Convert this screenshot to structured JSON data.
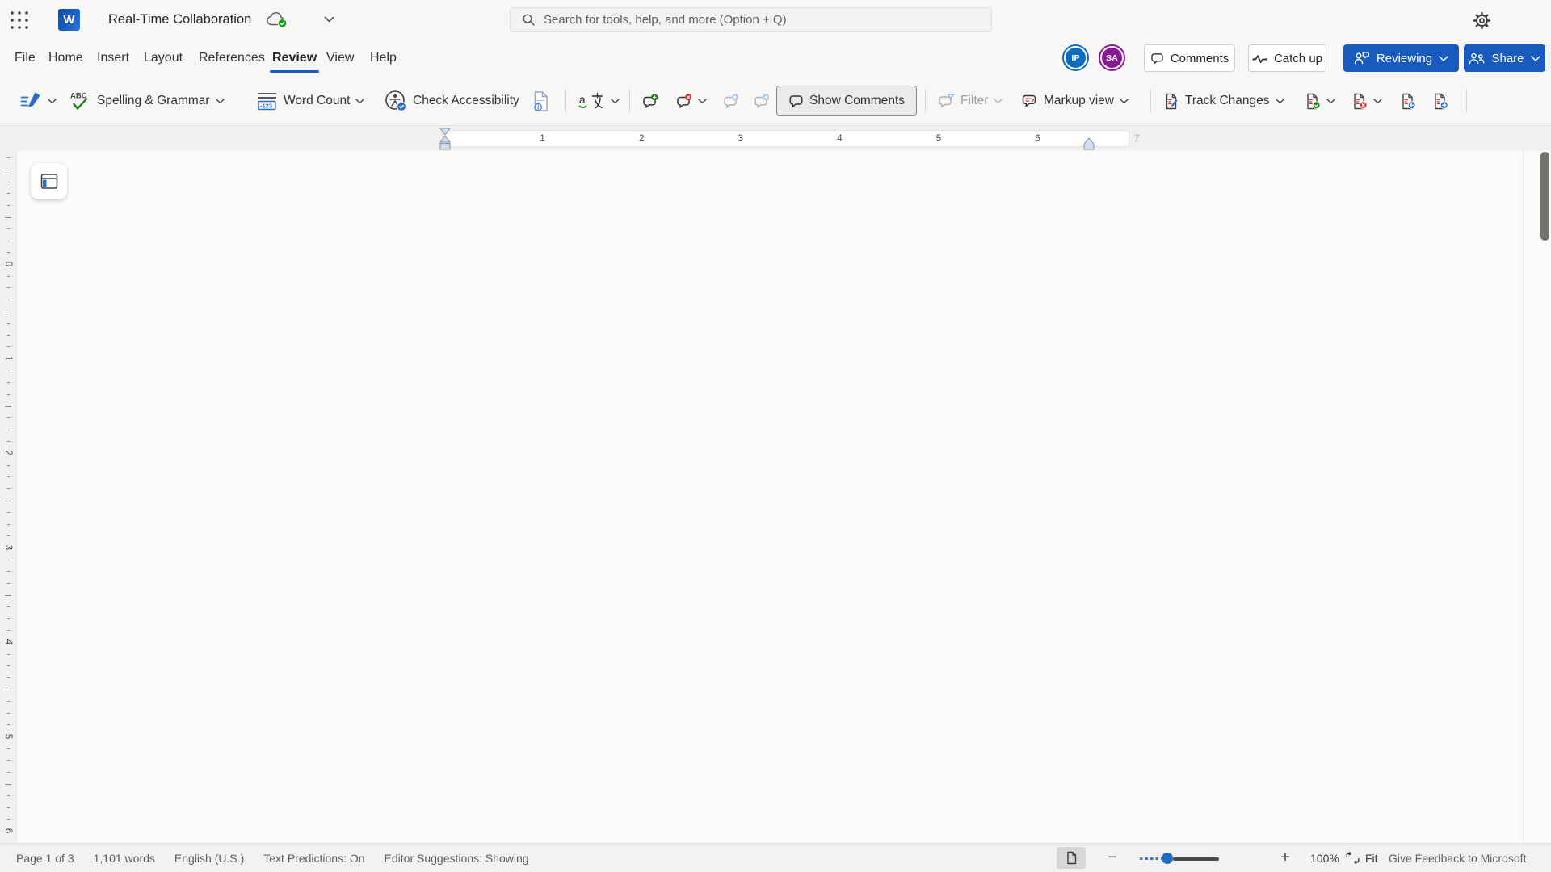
{
  "colors": {
    "accent_blue": "#185abd",
    "avatar_ip_blue": "#0f6cbd",
    "avatar_sa_purple": "#8a1798",
    "success_green": "#107c10",
    "error_red": "#d13438"
  },
  "top_bar": {
    "title": "Real-Time Collaboration",
    "search_placeholder": "Search for tools, help, and more (Option + Q)"
  },
  "menu_bar": {
    "tabs": [
      {
        "label": "File"
      },
      {
        "label": "Home"
      },
      {
        "label": "Insert"
      },
      {
        "label": "Layout"
      },
      {
        "label": "References"
      },
      {
        "label": "Review",
        "active": true
      },
      {
        "label": "View"
      },
      {
        "label": "Help"
      }
    ],
    "avatars": [
      {
        "initials": "IP"
      },
      {
        "initials": "SA"
      }
    ],
    "comments_button": "Comments",
    "catch_up_button": "Catch up",
    "reviewing_button": "Reviewing",
    "share_button": "Share"
  },
  "toolbar": {
    "spelling_grammar": "Spelling & Grammar",
    "word_count": "Word Count",
    "check_accessibility": "Check Accessibility",
    "show_comments": "Show Comments",
    "filter": "Filter",
    "markup_view": "Markup view",
    "track_changes": "Track Changes"
  },
  "ruler": {
    "horizontal_numbers": [
      "1",
      "2",
      "3",
      "4",
      "5",
      "6",
      "7"
    ],
    "vertical_numbers": [
      "0",
      "1",
      "2",
      "3",
      "4",
      "5",
      "6"
    ]
  },
  "status_bar": {
    "page_indicator": "Page 1 of 3",
    "word_count": "1,101 words",
    "language": "English (U.S.)",
    "text_predictions": "Text Predictions: On",
    "editor_suggestions": "Editor Suggestions: Showing",
    "zoom_percent": "100%",
    "fit_label": "Fit",
    "feedback_label": "Give Feedback to Microsoft"
  }
}
